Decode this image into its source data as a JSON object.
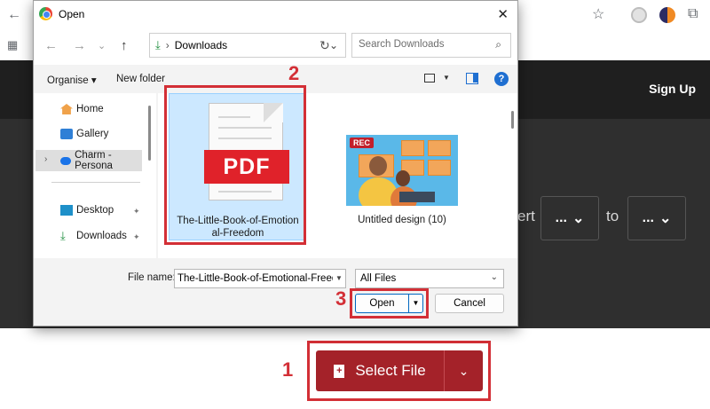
{
  "browser": {
    "back_icon": "arrow-left-icon",
    "star_icon": "star-icon",
    "extension_icon": "puzzle-piece-icon",
    "apps_icon": "apps-grid-icon"
  },
  "site": {
    "sign_up": "Sign Up",
    "convert_partial": "ert",
    "from_value": "...",
    "to_label": "to",
    "to_value": "...",
    "select_file_label": "Select File",
    "accent_color": "#a42229"
  },
  "steps": {
    "one": "1",
    "two": "2",
    "three": "3"
  },
  "dialog": {
    "title": "Open",
    "close_glyph": "✕",
    "address": "Downloads",
    "search_placeholder": "Search Downloads",
    "toolbar": {
      "organise": "Organise ▾",
      "new_folder": "New folder",
      "help": "?"
    },
    "sidebar": [
      {
        "label": "Home",
        "icon": "home-icon"
      },
      {
        "label": "Gallery",
        "icon": "gallery-icon"
      },
      {
        "label": "Charm - Persona",
        "icon": "onedrive-cloud-icon"
      },
      {
        "label": "Desktop",
        "icon": "desktop-icon"
      },
      {
        "label": "Downloads",
        "icon": "download-icon"
      }
    ],
    "files": [
      {
        "name_line1": "The-Little-Book-of-Emotion",
        "name_line2": "al-Freedom",
        "badge": "PDF",
        "icon": "pdf-file-icon"
      },
      {
        "name": "Untitled design (10)",
        "badge": "REC",
        "icon": "image-thumbnail-icon"
      }
    ],
    "filename_label": "File name:",
    "filename_value": "The-Little-Book-of-Emotional-Freedom",
    "filetype_value": "All Files",
    "open_label": "Open",
    "cancel_label": "Cancel"
  }
}
